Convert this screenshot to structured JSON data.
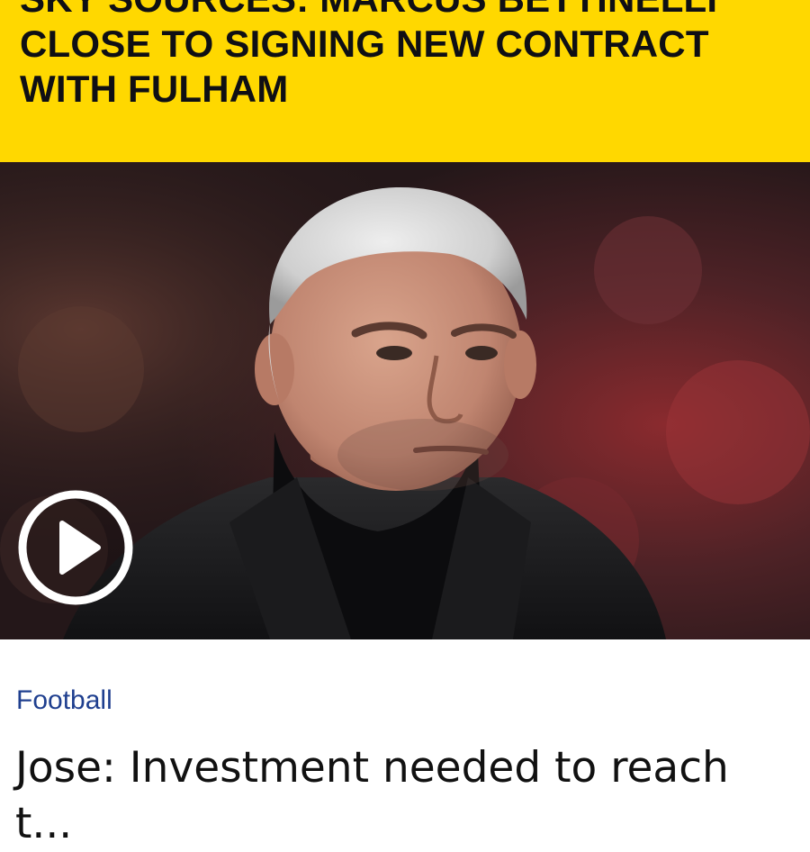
{
  "banner": {
    "headline": "Sky Sources: Marcus Bettinelli close to signing new contract with Fulham",
    "background_color": "#ffd800"
  },
  "hero": {
    "image": "portrait-photo",
    "play_icon": "play-icon"
  },
  "article": {
    "category": "Football",
    "category_color": "#1f3f8f",
    "title": "Jose: Investment needed to reach t..."
  }
}
